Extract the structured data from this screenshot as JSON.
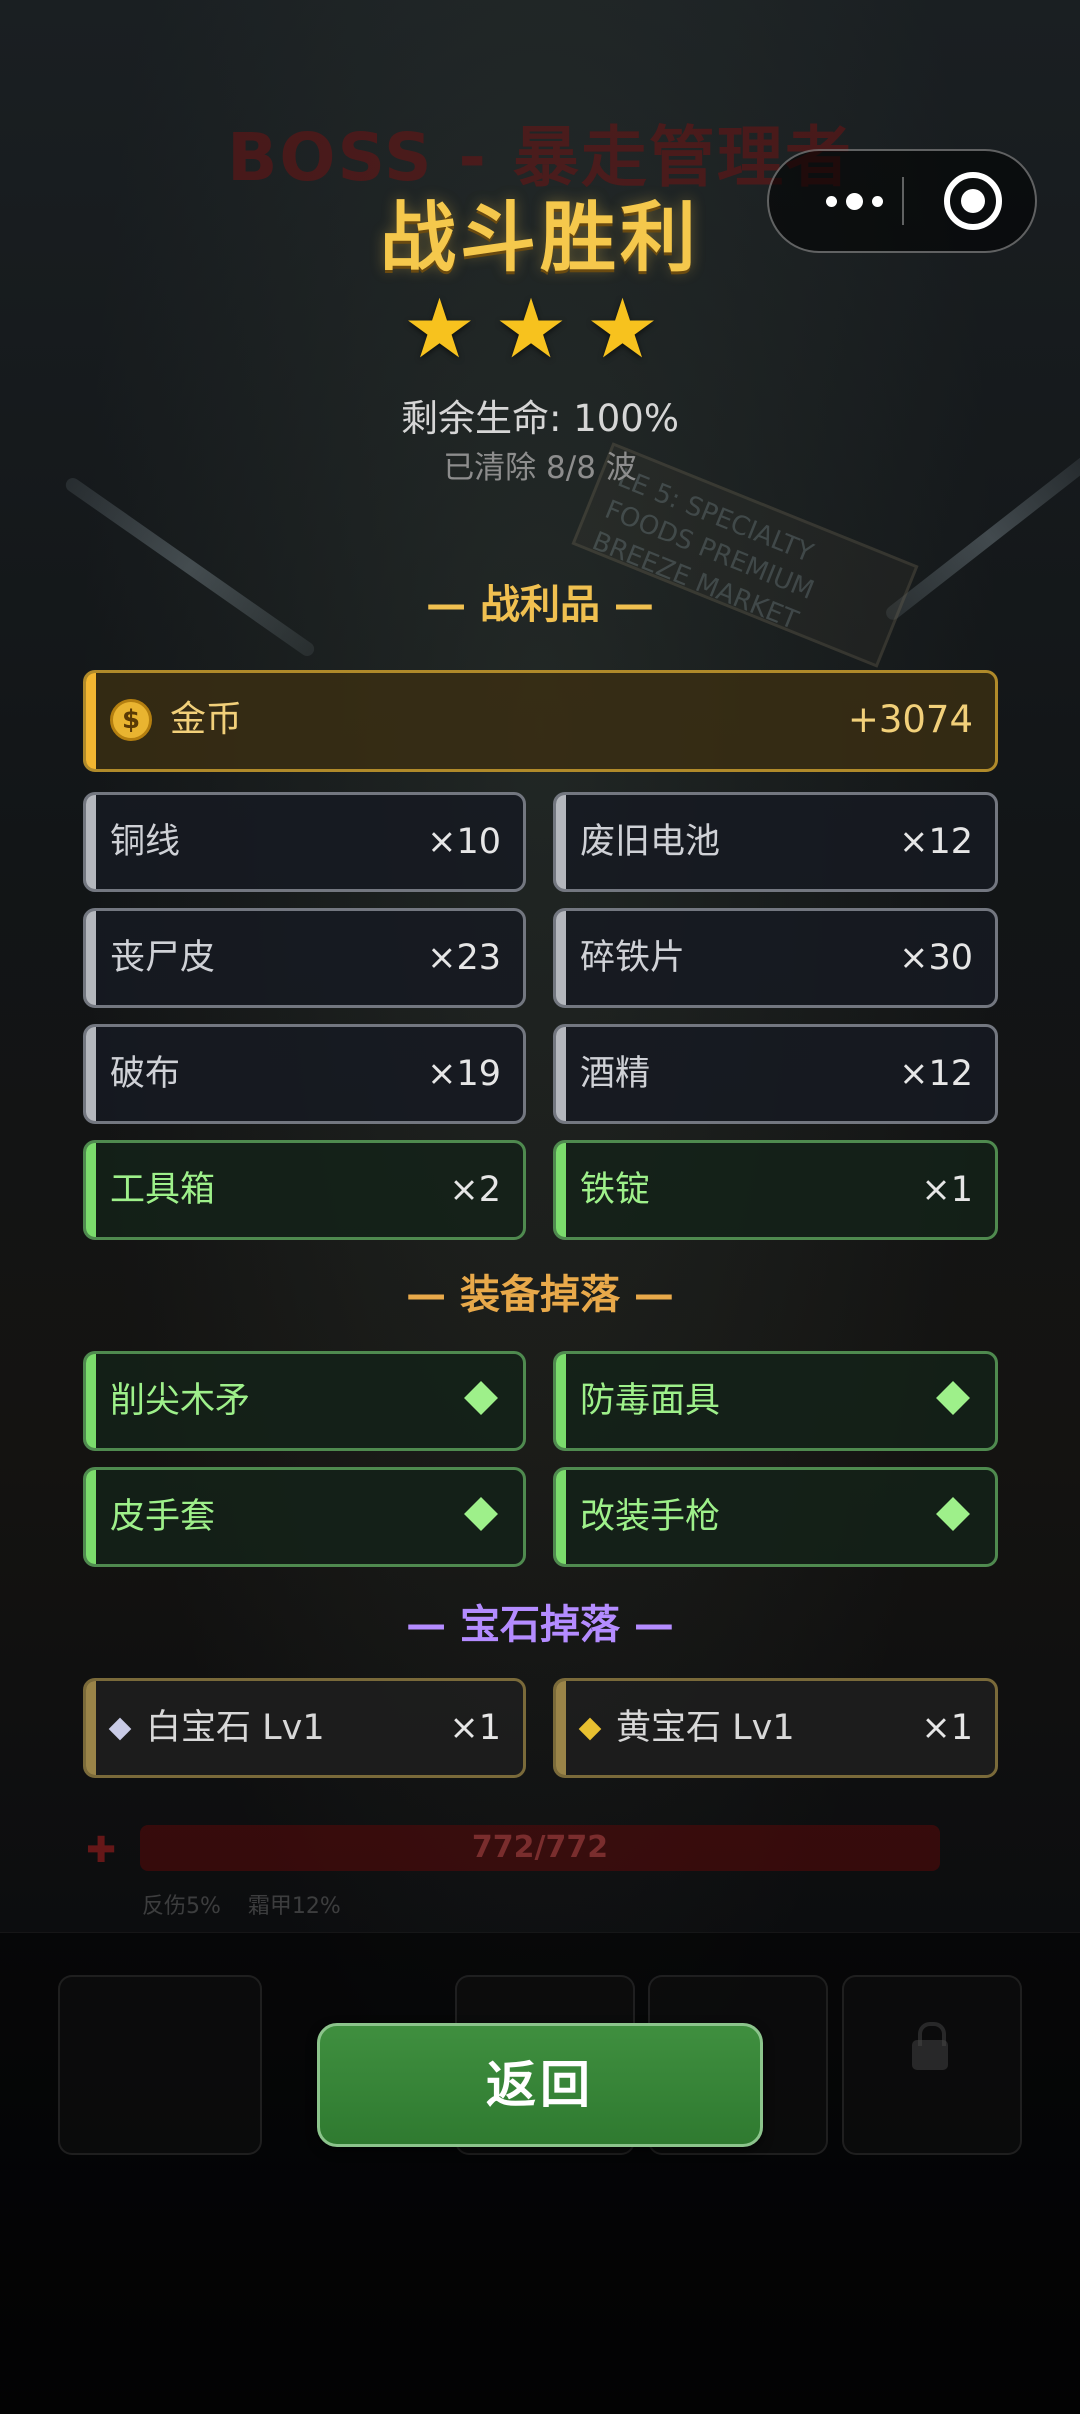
{
  "background": {
    "boss_title": "BOSS - 暴走管理者",
    "sign_text": "LE 5: SPECIALTY FOODS PREMIUM BREEZE MARKET",
    "hp_bar_text": "772/772",
    "status_text": "反伤5%  霜甲12%"
  },
  "result": {
    "title": "战斗胜利",
    "stars": "★★★",
    "star_count": 3,
    "hp_text": "剩余生命: 100%",
    "wave_text": "已清除 8/8 波"
  },
  "loot": {
    "title": "— 战利品 —",
    "gold": {
      "label": "金币",
      "amount": "+3074",
      "icon": "coin-icon",
      "icon_glyph": "$"
    },
    "items": [
      {
        "name": "铜线",
        "qty": "×10",
        "rarity": "gray"
      },
      {
        "name": "废旧电池",
        "qty": "×12",
        "rarity": "gray"
      },
      {
        "name": "丧尸皮",
        "qty": "×23",
        "rarity": "gray"
      },
      {
        "name": "碎铁片",
        "qty": "×30",
        "rarity": "gray"
      },
      {
        "name": "破布",
        "qty": "×19",
        "rarity": "gray"
      },
      {
        "name": "酒精",
        "qty": "×12",
        "rarity": "gray"
      },
      {
        "name": "工具箱",
        "qty": "×2",
        "rarity": "green"
      },
      {
        "name": "铁锭",
        "qty": "×1",
        "rarity": "green"
      }
    ]
  },
  "equipment": {
    "title": "— 装备掉落 —",
    "items": [
      {
        "name": "削尖木矛",
        "icon": "diamond-icon"
      },
      {
        "name": "防毒面具",
        "icon": "diamond-icon"
      },
      {
        "name": "皮手套",
        "icon": "diamond-icon"
      },
      {
        "name": "改装手枪",
        "icon": "diamond-icon"
      }
    ]
  },
  "gems": {
    "title": "— 宝石掉落 —",
    "items": [
      {
        "name": "白宝石 Lv1",
        "qty": "×1",
        "color": "#c9cbe6"
      },
      {
        "name": "黄宝石 Lv1",
        "qty": "×1",
        "color": "#e8c030"
      }
    ]
  },
  "actions": {
    "return_label": "返回"
  },
  "colors": {
    "title_gold": "#f5c84c",
    "star": "#f7c21e",
    "loot_title": "#f0c050",
    "equip_title": "#e8a94a",
    "gem_title": "#b48cff",
    "green_item": "#9ef08a",
    "return_button": "#3a8a3a"
  }
}
